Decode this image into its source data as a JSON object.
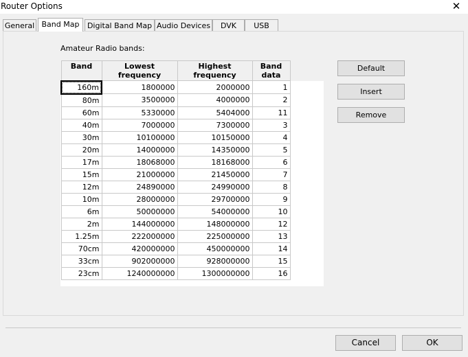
{
  "window": {
    "title": "Router Options",
    "close_glyph": "✕"
  },
  "tabs": [
    {
      "label": "General"
    },
    {
      "label": "Band Map"
    },
    {
      "label": "Digital Band Map"
    },
    {
      "label": "Audio Devices"
    },
    {
      "label": "DVK"
    },
    {
      "label": "USB"
    }
  ],
  "active_tab": "Band Map",
  "table_label": "Amateur Radio bands:",
  "columns": [
    {
      "line1": "Band",
      "line2": ""
    },
    {
      "line1": "Lowest",
      "line2": "frequency"
    },
    {
      "line1": "Highest",
      "line2": "frequency"
    },
    {
      "line1": "Band",
      "line2": "data"
    }
  ],
  "rows": [
    [
      "160m",
      "1800000",
      "2000000",
      "1"
    ],
    [
      "80m",
      "3500000",
      "4000000",
      "2"
    ],
    [
      "60m",
      "5330000",
      "5404000",
      "11"
    ],
    [
      "40m",
      "7000000",
      "7300000",
      "3"
    ],
    [
      "30m",
      "10100000",
      "10150000",
      "4"
    ],
    [
      "20m",
      "14000000",
      "14350000",
      "5"
    ],
    [
      "17m",
      "18068000",
      "18168000",
      "6"
    ],
    [
      "15m",
      "21000000",
      "21450000",
      "7"
    ],
    [
      "12m",
      "24890000",
      "24990000",
      "8"
    ],
    [
      "10m",
      "28000000",
      "29700000",
      "9"
    ],
    [
      "6m",
      "50000000",
      "54000000",
      "10"
    ],
    [
      "2m",
      "144000000",
      "148000000",
      "12"
    ],
    [
      "1.25m",
      "222000000",
      "225000000",
      "13"
    ],
    [
      "70cm",
      "420000000",
      "450000000",
      "14"
    ],
    [
      "33cm",
      "902000000",
      "928000000",
      "15"
    ],
    [
      "23cm",
      "1240000000",
      "1300000000",
      "16"
    ]
  ],
  "side_buttons": {
    "default_label": "Default",
    "insert_label": "Insert",
    "remove_label": "Remove"
  },
  "footer": {
    "cancel_label": "Cancel",
    "ok_label": "OK"
  }
}
